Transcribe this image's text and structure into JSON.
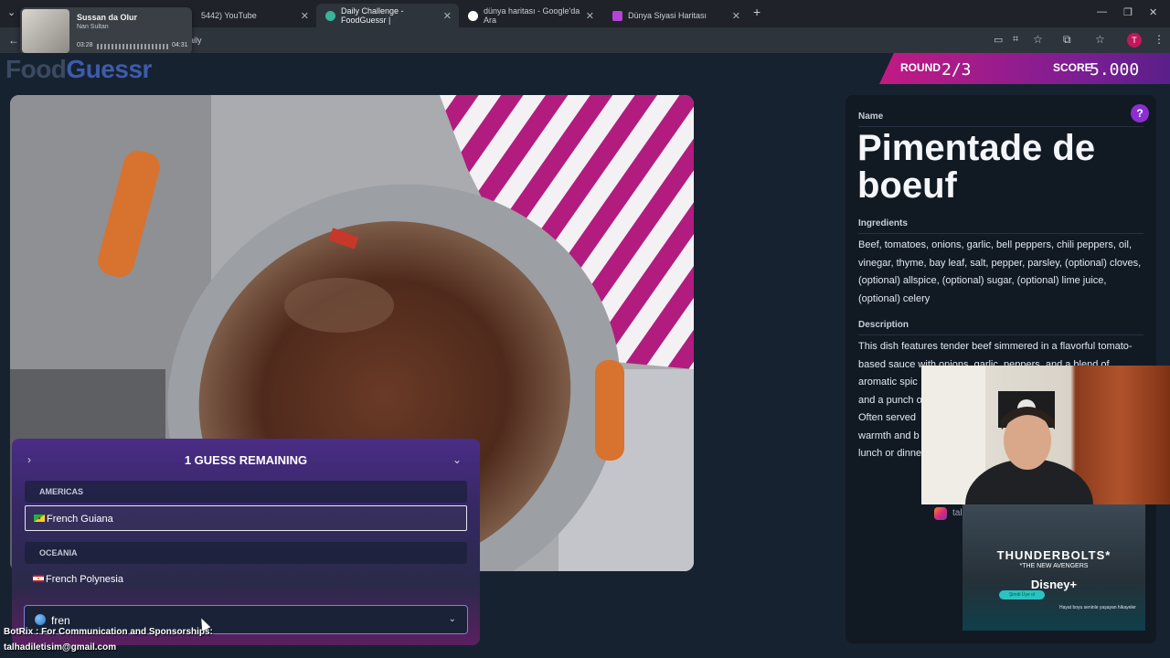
{
  "browser": {
    "tabs": [
      {
        "label": "5442) YouTube",
        "color": "#ff0000"
      },
      {
        "label": "Daily Challenge - FoodGuessr |",
        "color": "#3bb39a",
        "active": true
      },
      {
        "label": "dünya haritası - Google'da Ara",
        "color": "#ffffff"
      },
      {
        "label": "Dünya Siyasi Haritası",
        "color": "#b544d6"
      }
    ],
    "address_fragment": "daily",
    "new_tab": "+",
    "avatar_letter": "T"
  },
  "media": {
    "title": "Sussan da Olur",
    "artist": "Nan Sultan",
    "elapsed": "03:28",
    "duration": "04:31"
  },
  "logo": {
    "part1": "Food",
    "part2": "Guessr"
  },
  "score": {
    "round_label": "ROUND",
    "round_value": "2/3",
    "score_label": "SCORE",
    "score_value": "5.000"
  },
  "dish": {
    "name_label": "Name",
    "name": "Pimentade de boeuf",
    "ingredients_label": "Ingredients",
    "ingredients": "Beef, tomatoes, onions, garlic, bell peppers, chili peppers, oil, vinegar, thyme, bay leaf, salt, pepper, parsley, (optional) cloves, (optional) allspice, (optional) sugar, (optional) lime juice, (optional) celery",
    "description_label": "Description",
    "description_lines": [
      "This dish features tender beef simmered in a flavorful tomato-",
      "based sauce with onions, garlic, peppers, and a blend of",
      "aromatic spic",
      "and a punch o",
      "Often served",
      "warmth and b",
      "lunch or dinne"
    ]
  },
  "guess_panel": {
    "header": "1 GUESS REMAINING",
    "groups": [
      {
        "name": "AMERICAS",
        "options": [
          {
            "label": "French Guiana",
            "selected": true
          }
        ]
      },
      {
        "name": "OCEANIA",
        "options": [
          {
            "label": "French Polynesia",
            "selected": false
          }
        ]
      }
    ],
    "input_value": "fren"
  },
  "overlays": {
    "instagram_handle": "talhadiler",
    "ad_title": "THUNDERBOLTS*",
    "ad_subtitle": "*THE NEW AVENGERS",
    "ad_brand": "Disney+",
    "ad_button": "Şimdi Üye ol",
    "ad_tagline": "Hayat boyu seninle yaşayan hikayeler",
    "chat_line": "BotRix : For Communication and Sponsorships:",
    "chat_email": "talhadiletisim@gmail.com"
  }
}
